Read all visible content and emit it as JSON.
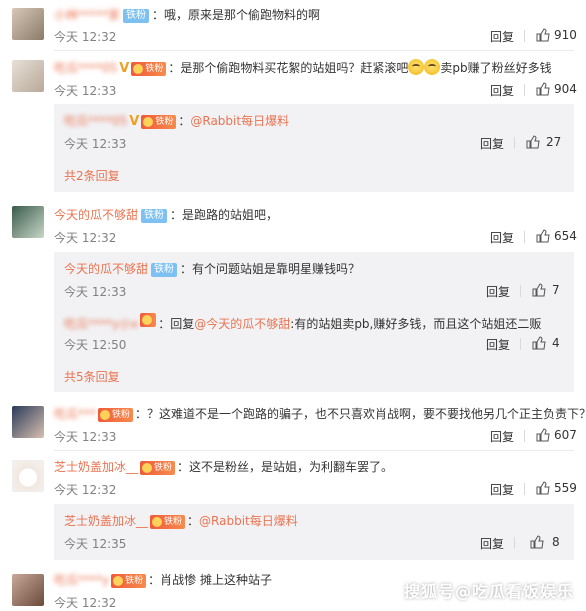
{
  "colors": {
    "accent": "#eb7350",
    "badge_blue": "#7dc0f2",
    "reply_bg": "#f2f2f5"
  },
  "labels": {
    "reply": "回复",
    "fan_badge": "铁粉"
  },
  "comments": [
    {
      "user": "小林*****家",
      "text": "哦，原来是那个偷跑物料的啊",
      "time": "今天 12:32",
      "likes": "910"
    },
    {
      "user": "吃瓜****05",
      "text": "是那个偷跑物料买花絮的站姐吗？赶紧滚吧",
      "text2": "卖pb赚了粉丝好多钱",
      "time": "今天 12:33",
      "likes": "904",
      "reply": {
        "user": "吃瓜****05",
        "prefix": "：",
        "mention": "@Rabbit每日爆料",
        "time": "今天 12:33",
        "likes": "27"
      },
      "more": "共2条回复"
    },
    {
      "user": "今天的瓜不够甜",
      "text": "是跑路的站姐吧，",
      "time": "今天 12:32",
      "likes": "654",
      "reply": {
        "user": "今天的瓜不够甜",
        "text": "有个问题站姐是靠明星赚钱吗？",
        "time": "今天 12:33",
        "likes": "7"
      },
      "reply2": {
        "user": "吃瓜****y小x",
        "prefix": "回复",
        "mention": "@今天的瓜不够甜",
        "text": "有的站姐卖pb,赚好多钱，而且这个站姐还二贩",
        "time": "今天 12:50",
        "likes": "4"
      },
      "more": "共5条回复"
    },
    {
      "user": "吃瓜***",
      "text": "？这难道不是一个跑路的骗子，也不只喜欢肖战啊，要不要找他另几个正主负责下？",
      "time": "今天 12:33",
      "likes": "607"
    },
    {
      "user": "芝士奶盖加冰__",
      "text": "这不是粉丝，是站姐，为利翻车罢了。",
      "time": "今天 12:32",
      "likes": "559",
      "reply": {
        "user": "芝士奶盖加冰__",
        "mention": "@Rabbit每日爆料",
        "time": "今天 12:35",
        "likes": "8"
      }
    },
    {
      "user": "吃瓜****y",
      "text": "肖战惨  摊上这种站子",
      "time": "今天 12:32"
    }
  ],
  "watermark": "搜狐号@吃瓜看饭娱乐"
}
